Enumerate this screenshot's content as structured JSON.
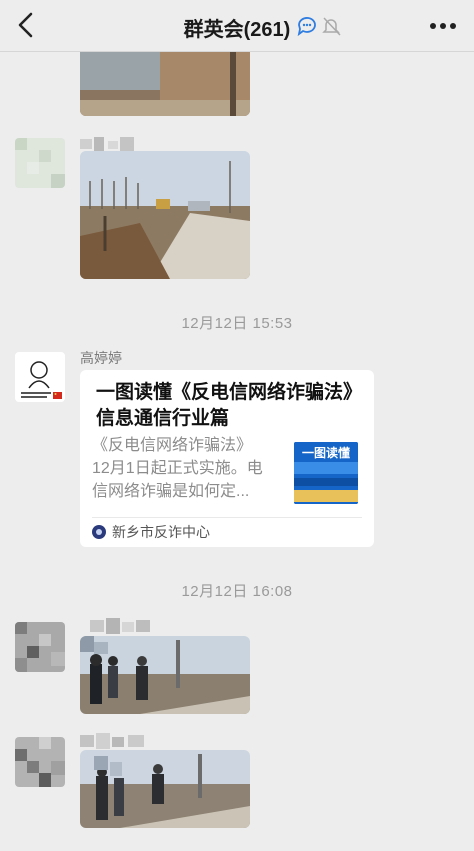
{
  "header": {
    "title": "群英会(261)",
    "back_icon": "chevron-left-icon",
    "status_icons": [
      "chat-bubble-icon",
      "mute-bell-icon"
    ],
    "more_icon": "more-dots-icon"
  },
  "messages": [
    {
      "type": "image",
      "description": "partial photo"
    },
    {
      "type": "image",
      "description": "construction site photo"
    },
    {
      "type": "timestamp",
      "text": "12月12日 15:53"
    },
    {
      "type": "link-card",
      "sender": "高婷婷",
      "title": "一图读懂《反电信网络诈骗法》信息通信行业篇",
      "description": "《反电信网络诈骗法》12月1日起正式实施。电信网络诈骗是如何定...",
      "thumbnail_text": "一图读懂",
      "source": "新乡市反诈中心"
    },
    {
      "type": "timestamp",
      "text": "12月12日 16:08"
    },
    {
      "type": "image",
      "description": "people at roadside photo"
    },
    {
      "type": "image",
      "description": "people at roadside photo"
    }
  ],
  "colors": {
    "background": "#ededed",
    "card": "#ffffff",
    "timestamp": "#9a9a9a"
  }
}
